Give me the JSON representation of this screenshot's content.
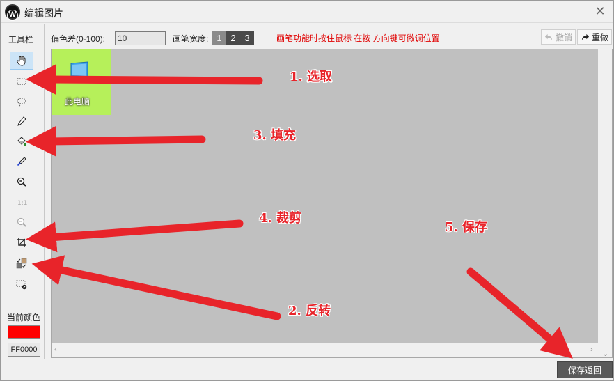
{
  "window": {
    "title": "编辑图片",
    "logo_letter": "W",
    "close_glyph": "✕"
  },
  "toolbar": {
    "title": "工具栏",
    "tools": [
      {
        "name": "hand-icon",
        "active": true
      },
      {
        "name": "rect-select-icon",
        "active": false
      },
      {
        "name": "lasso-select-icon",
        "active": false
      },
      {
        "name": "pencil-icon",
        "active": false
      },
      {
        "name": "fill-bucket-icon",
        "active": false
      },
      {
        "name": "color-picker-icon",
        "active": false
      },
      {
        "name": "zoom-in-icon",
        "active": false
      },
      {
        "name": "actual-size-icon",
        "active": false
      },
      {
        "name": "zoom-out-icon",
        "active": false
      },
      {
        "name": "crop-icon",
        "active": false
      },
      {
        "name": "swap-color-icon",
        "active": false
      },
      {
        "name": "clear-selection-icon",
        "active": false
      }
    ],
    "current_color_label": "当前颜色",
    "current_color": "#FF0000",
    "current_color_hex": "FF0000"
  },
  "options": {
    "tolerance_label": "偏色差(0-100):",
    "tolerance_value": "10",
    "pen_width_label": "画笔宽度:",
    "pen_widths": [
      "1",
      "2",
      "3"
    ],
    "selected_pen_width": "1",
    "hint": "画笔功能时按住鼠标 在按 方向键可微调位置",
    "undo_label": "撤销",
    "redo_label": "重做"
  },
  "canvas": {
    "desktop_icon_label": "此电脑",
    "background": "#c0c0c0",
    "icon_bg": "#b6f05a"
  },
  "footer": {
    "save_label": "保存返回"
  },
  "annotations": [
    {
      "text": "1. 选取"
    },
    {
      "text": "3. 填充"
    },
    {
      "text": "4. 裁剪"
    },
    {
      "text": "5. 保存"
    },
    {
      "text": "2. 反转"
    }
  ],
  "accent_colors": {
    "annotation_red": "#e8242a",
    "hint_red": "#e00000"
  }
}
